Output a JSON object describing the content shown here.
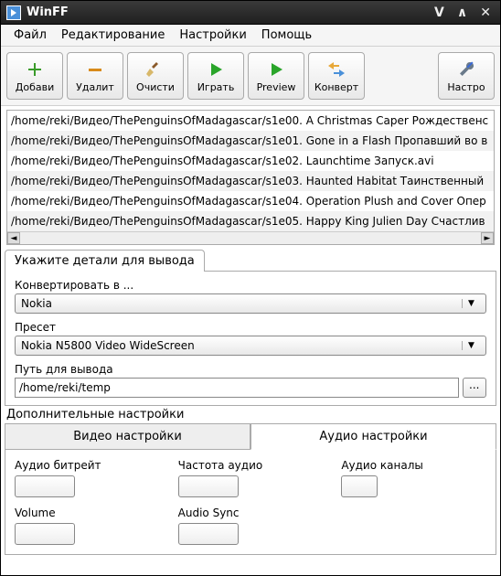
{
  "window": {
    "title": "WinFF"
  },
  "menubar": [
    "Файл",
    "Редактирование",
    "Настройки",
    "Помощь"
  ],
  "toolbar": {
    "add": "Добави",
    "remove": "Удалит",
    "clear": "Очисти",
    "play": "Играть",
    "preview": "Preview",
    "convert": "Конверт",
    "options": "Настро"
  },
  "files": [
    "/home/reki/Видео/ThePenguinsOfMadagascar/s1e00. A Christmas Caper Рождественс",
    "/home/reki/Видео/ThePenguinsOfMadagascar/s1e01. Gone in a Flash Пропавший во в",
    "/home/reki/Видео/ThePenguinsOfMadagascar/s1e02. Launchtime Запуск.avi",
    "/home/reki/Видео/ThePenguinsOfMadagascar/s1e03. Haunted Habitat Таинственный",
    "/home/reki/Видео/ThePenguinsOfMadagascar/s1e04. Operation Plush and Cover Опер",
    "/home/reki/Видео/ThePenguinsOfMadagascar/s1e05. Happy King Julien Day Счастлив"
  ],
  "output": {
    "tabLabel": "Укажите детали для вывода",
    "convertToLabel": "Конвертировать в ...",
    "convertToValue": "Nokia",
    "presetLabel": "Пресет",
    "presetValue": "Nokia N5800 Video WideScreen",
    "pathLabel": "Путь для вывода",
    "pathValue": "/home/reki/temp",
    "browse": "..."
  },
  "advanced": {
    "title": "Дополнительные настройки",
    "videoTab": "Видео настройки",
    "audioTab": "Аудио настройки",
    "audio": {
      "bitrate": "Аудио битрейт",
      "freq": "Частота аудио",
      "channels": "Аудио каналы",
      "volume": "Volume",
      "sync": "Audio Sync"
    }
  }
}
